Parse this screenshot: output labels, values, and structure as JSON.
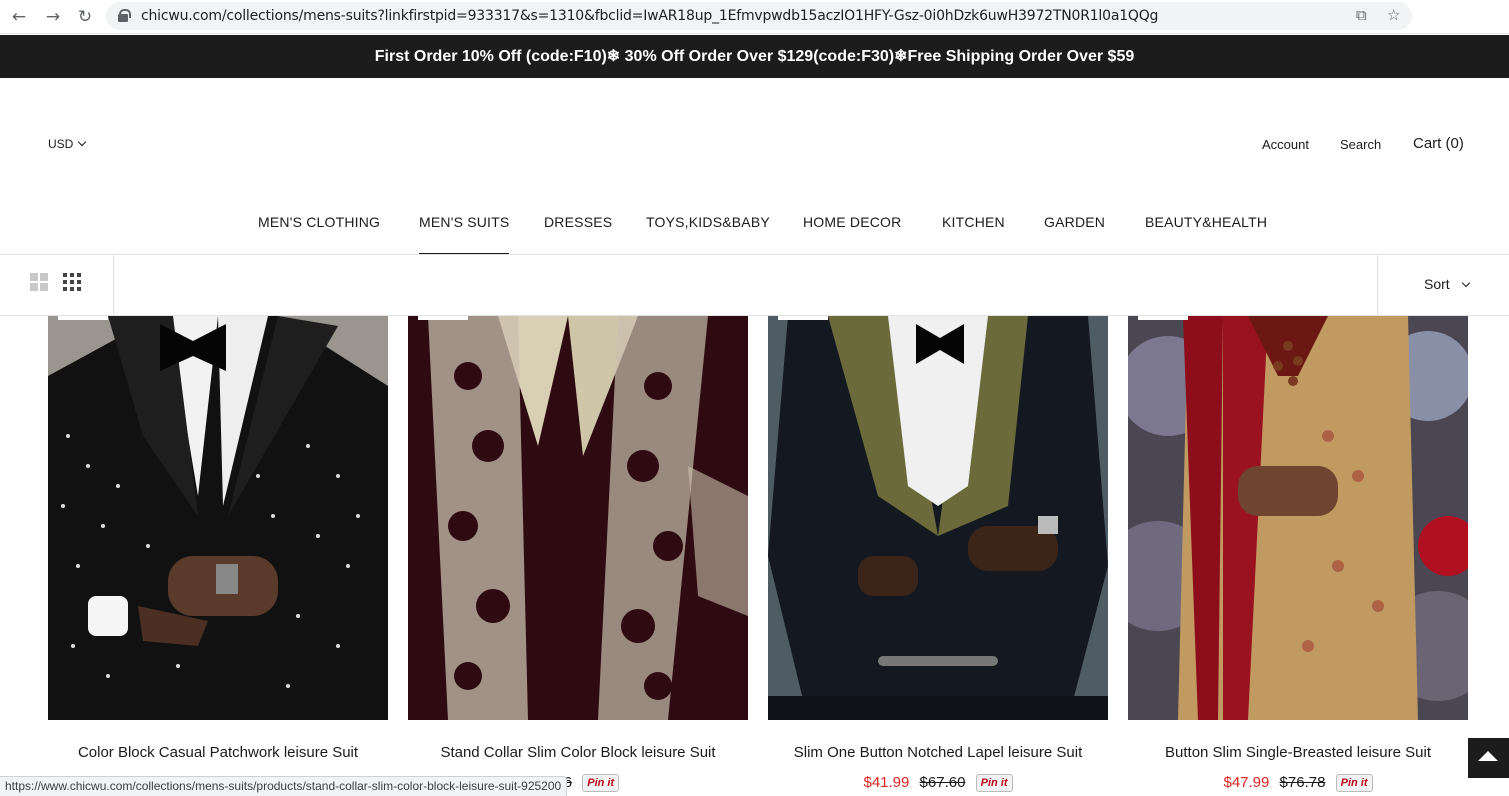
{
  "browser": {
    "back_icon": "←",
    "forward_icon": "→",
    "reload_icon": "↻",
    "url": "chicwu.com/collections/mens-suits?linkfirstpid=933317&s=1310&fbclid=IwAR18up_1Efmvpwdb15aczIO1HFY-Gsz-0i0hDzk6uwH3972TN0R1l0a1QQg",
    "cast_icon": "⧉",
    "star_icon": "☆"
  },
  "announcement": "First Order 10% Off (code:F10)❄ 30% Off Order Over $129(code:F30)❄Free Shipping Order Over $59",
  "header": {
    "currency": "USD",
    "account": "Account",
    "search": "Search",
    "cart": "Cart (0)"
  },
  "nav": [
    {
      "label": "MEN'S CLOTHING"
    },
    {
      "label": "MEN'S SUITS"
    },
    {
      "label": "DRESSES"
    },
    {
      "label": "TOYS,KIDS&BABY"
    },
    {
      "label": "HOME DECOR"
    },
    {
      "label": "KITCHEN"
    },
    {
      "label": "GARDEN"
    },
    {
      "label": "BEAUTY&HEALTH"
    }
  ],
  "toolbar": {
    "sort_label": "Sort"
  },
  "products": [
    {
      "title": "Color Block Casual Patchwork leisure Suit",
      "price": "",
      "old_price": "",
      "pin": ""
    },
    {
      "title": "Stand Collar Slim Color Block leisure Suit",
      "price": "",
      "old_price": "3.86",
      "pin": "Pin it"
    },
    {
      "title": "Slim One Button Notched Lapel leisure Suit",
      "price": "$41.99",
      "old_price": "$67.60",
      "pin": "Pin it"
    },
    {
      "title": "Button Slim Single-Breasted leisure Suit",
      "price": "$47.99",
      "old_price": "$76.78",
      "pin": "Pin it"
    }
  ],
  "status_url": "https://www.chicwu.com/collections/mens-suits/products/stand-collar-slim-color-block-leisure-suit-925200",
  "colors": {
    "announcement_bg": "#1c1c1c",
    "price_sale": "#e22120",
    "text": "#1c1b1b"
  }
}
